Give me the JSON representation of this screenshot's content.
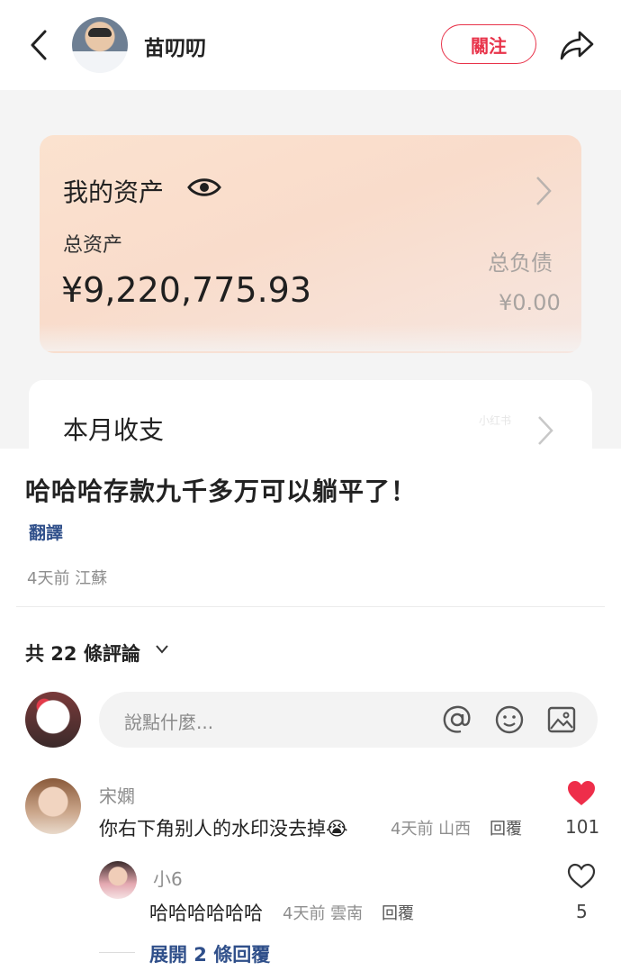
{
  "header": {
    "author_name": "苗叨叨",
    "follow_label": "關注",
    "accent_color": "#e8334a"
  },
  "image": {
    "asset_title": "我的资产",
    "total_label": "总资产",
    "total_value": "¥9,220,775.93",
    "debt_label": "总负债",
    "debt_value": "¥0.00",
    "monthly_title": "本月收支",
    "watermark_text": "小红书"
  },
  "post": {
    "title": "哈哈哈存款九千多万可以躺平了！",
    "translate_label": "翻譯",
    "meta": "4天前 江蘇"
  },
  "comments_section": {
    "count_label": "共 22 條評論",
    "input_placeholder": "說點什麼..."
  },
  "comments": [
    {
      "name": "宋嫻",
      "text": "你右下角别人的水印没去掉😭",
      "meta": "4天前 山西",
      "reply_label": "回覆",
      "likes": "101",
      "liked": true
    },
    {
      "name": "小6",
      "text": "哈哈哈哈哈哈",
      "meta": "4天前 雲南",
      "reply_label": "回覆",
      "likes": "5",
      "liked": false
    }
  ],
  "expand_label": "展開 2 條回覆",
  "icons": [
    "back-icon",
    "share-icon",
    "eye-icon",
    "chevron-right-icon",
    "chevron-down-icon",
    "at-icon",
    "emoji-icon",
    "image-icon",
    "heart-filled-icon",
    "heart-outline-icon"
  ]
}
